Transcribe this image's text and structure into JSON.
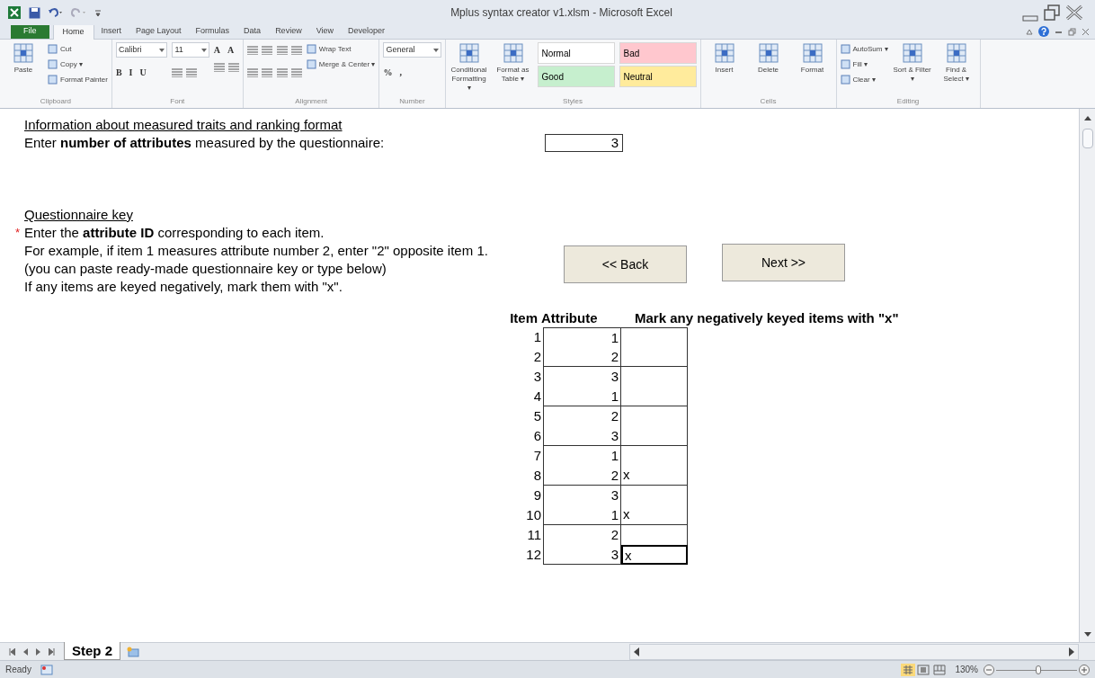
{
  "window": {
    "title": "Mplus syntax creator v1.xlsm - Microsoft Excel"
  },
  "tabs": [
    {
      "label": "File",
      "kind": "file"
    },
    {
      "label": "Home",
      "selected": true,
      "kind": "tab"
    },
    {
      "label": "Insert",
      "selected": false,
      "kind": "tab"
    },
    {
      "label": "Page Layout",
      "selected": false,
      "kind": "tab"
    },
    {
      "label": "Formulas",
      "selected": false,
      "kind": "tab"
    },
    {
      "label": "Data",
      "selected": false,
      "kind": "tab"
    },
    {
      "label": "Review",
      "selected": false,
      "kind": "tab"
    },
    {
      "label": "View",
      "selected": false,
      "kind": "tab"
    },
    {
      "label": "Developer",
      "selected": false,
      "kind": "tab"
    }
  ],
  "ribbon": [
    {
      "label": "Clipboard",
      "columns": [
        [
          {
            "kind": "large",
            "label": "Paste"
          }
        ],
        [
          {
            "kind": "small",
            "label": "Cut"
          },
          {
            "kind": "small",
            "label": "Copy ▾"
          },
          {
            "kind": "small",
            "label": "Format Painter"
          }
        ]
      ]
    },
    {
      "label": "Font",
      "columns": [
        [
          {
            "kind": "combo",
            "label": "Calibri"
          },
          {
            "kind": "emphasis",
            "labels": [
              "B",
              "I",
              "U"
            ]
          }
        ],
        [
          {
            "kind": "combo",
            "label": "11"
          },
          {
            "kind": "icon"
          }
        ],
        [
          {
            "kind": "font-size",
            "labels": [
              "A",
              "A"
            ]
          },
          {
            "kind": "icon"
          }
        ]
      ]
    },
    {
      "label": "Alignment",
      "columns": [
        [
          {
            "kind": "icon"
          },
          {
            "kind": "icon"
          }
        ],
        [
          {
            "kind": "icon"
          },
          {
            "kind": "icon"
          }
        ],
        [
          {
            "kind": "small",
            "label": "Wrap Text"
          },
          {
            "kind": "small",
            "label": "Merge & Center ▾"
          }
        ]
      ]
    },
    {
      "label": "Number",
      "columns": [
        [
          {
            "kind": "combo",
            "label": "General"
          },
          {
            "kind": "number-format",
            "labels": [
              "%",
              ","
            ]
          }
        ]
      ]
    },
    {
      "label": "Styles",
      "columns": [
        [
          {
            "kind": "large",
            "label": "Conditional Formatting ▾"
          }
        ],
        [
          {
            "kind": "large",
            "label": "Format as Table ▾"
          }
        ],
        [
          {
            "kind": "style",
            "label": "Normal",
            "color": "#ffffff"
          },
          {
            "kind": "style",
            "label": "Good",
            "color": "#c6efce"
          }
        ],
        [
          {
            "kind": "style",
            "label": "Bad",
            "color": "#ffc7ce"
          },
          {
            "kind": "style",
            "label": "Neutral",
            "color": "#ffeb9c"
          }
        ]
      ]
    },
    {
      "label": "Cells",
      "columns": [
        [
          {
            "kind": "large",
            "label": "Insert"
          }
        ],
        [
          {
            "kind": "large",
            "label": "Delete"
          }
        ],
        [
          {
            "kind": "large",
            "label": "Format"
          }
        ]
      ]
    },
    {
      "label": "Editing",
      "columns": [
        [
          {
            "kind": "small",
            "label": "AutoSum ▾"
          },
          {
            "kind": "small",
            "label": "Fill ▾"
          },
          {
            "kind": "small",
            "label": "Clear ▾"
          }
        ],
        [
          {
            "kind": "large",
            "label": "Sort & Filter ▾"
          }
        ],
        [
          {
            "kind": "large",
            "label": "Find & Select ▾"
          }
        ]
      ]
    }
  ],
  "sheet": {
    "heading": "Information about measured traits and ranking format",
    "attributes_prompt": "Enter **number of attributes** measured by the questionnaire:",
    "attributes_value": "3",
    "key_heading": "Questionnaire key",
    "required_mark": "*",
    "instructions": [
      "Enter the **attribute ID** corresponding to each item.",
      "For example, if item 1 measures attribute number 2, enter \"2\" opposite item 1.",
      "(you can paste ready-made questionnaire key or type below)",
      "If any items are keyed negatively, mark them with \"x\"."
    ],
    "buttons": [
      "<< Back",
      "Next >>"
    ],
    "table": {
      "columns": [
        "Item",
        "Attribute",
        "Mark any negatively keyed items with \"x\""
      ],
      "rows": [
        {
          "item": "1",
          "attribute": "1",
          "selected": false
        },
        {
          "item": "2",
          "attribute": "2",
          "selected": false
        },
        {
          "item": "3",
          "attribute": "3",
          "selected": false
        },
        {
          "item": "4",
          "attribute": "1",
          "selected": false
        },
        {
          "item": "5",
          "attribute": "2",
          "selected": false
        },
        {
          "item": "6",
          "attribute": "3",
          "selected": false
        },
        {
          "item": "7",
          "attribute": "1",
          "selected": false
        },
        {
          "item": "8",
          "attribute": "2",
          "mark": "x",
          "selected": false
        },
        {
          "item": "9",
          "attribute": "3",
          "selected": false
        },
        {
          "item": "10",
          "attribute": "1",
          "mark": "x",
          "selected": false
        },
        {
          "item": "11",
          "attribute": "2",
          "selected": false
        },
        {
          "item": "12",
          "attribute": "3",
          "mark": "x",
          "selected": true
        }
      ]
    }
  },
  "sheet_tabs": [
    {
      "label": "Step 2",
      "selected": true
    }
  ],
  "status_bar": {
    "text": "Ready",
    "zoom": "130%",
    "zoom_slider": {
      "level": 0.52
    }
  }
}
